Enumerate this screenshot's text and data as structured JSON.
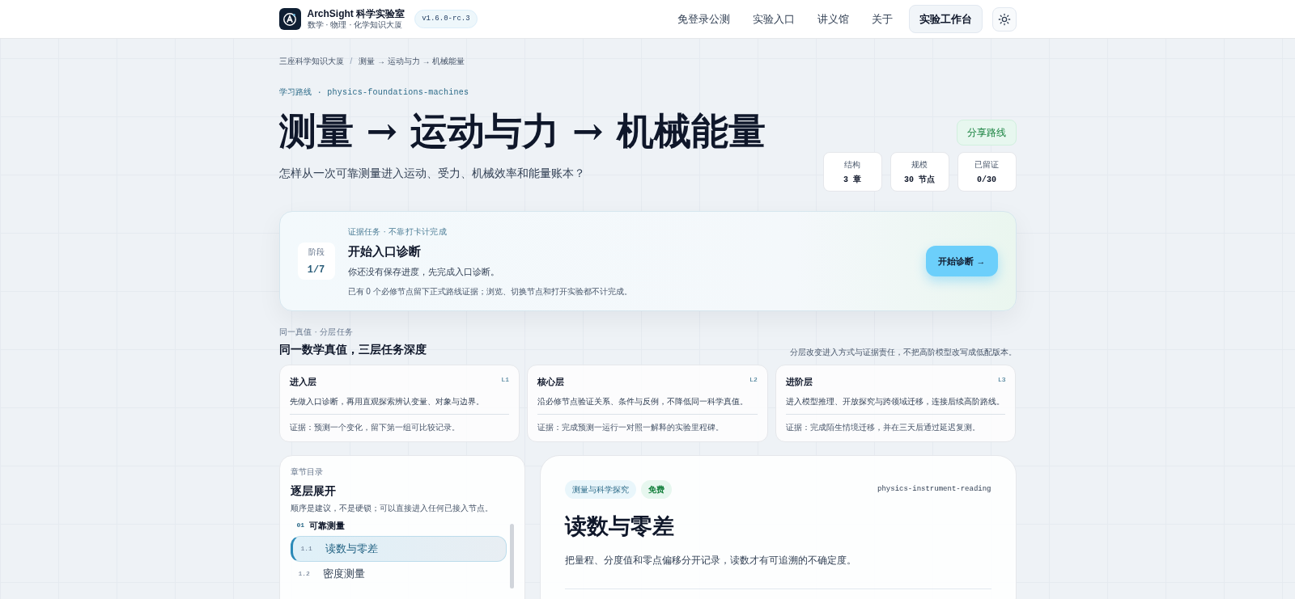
{
  "header": {
    "brand": "ArchSight 科学实验室",
    "tagline": "数学 · 物理 · 化学知识大厦",
    "version": "v1.6.0-rc.3",
    "nav": [
      {
        "label": "免登录公测",
        "kind": "link"
      },
      {
        "label": "实验入口",
        "kind": "link"
      },
      {
        "label": "讲义馆",
        "kind": "link"
      },
      {
        "label": "关于",
        "kind": "link"
      },
      {
        "label": "实验工作台",
        "kind": "button"
      }
    ]
  },
  "breadcrumb": [
    "三座科学知识大厦",
    "/",
    "测量 → 运动与力 → 机械能量"
  ],
  "eyebrow": "学习路线 · physics-foundations-machines",
  "title": "测量 → 运动与力 → 机械能量",
  "subtitle": "怎样从一次可靠测量进入运动、受力、机械效率和能量账本？",
  "share": "分享路线",
  "stats": [
    {
      "label": "结构",
      "value": "3 章"
    },
    {
      "label": "规模",
      "value": "30 节点"
    },
    {
      "label": "已留证",
      "value": "0/30"
    }
  ],
  "diagnosis": {
    "stage_label": "阶段",
    "stage": "1/7",
    "eyebrow": "证据任务 · 不靠打卡计完成",
    "title": "开始入口诊断",
    "text": "你还没有保存进度，先完成入口诊断。",
    "note": "已有 0 个必修节点留下正式路线证据；浏览、切换节点和打开实验都不计完成。",
    "button": "开始诊断 →"
  },
  "tiers": {
    "eyebrow": "同一真值 · 分层任务",
    "title": "同一数学真值，三层任务深度",
    "aside": "分层改变进入方式与证据责任，不把高阶模型改写成低配版本。",
    "cards": [
      {
        "title": "进入层",
        "level": "L1",
        "text": "先做入口诊断，再用直观探索辨认变量、对象与边界。",
        "evidence": "证据：预测一个变化，留下第一组可比较记录。"
      },
      {
        "title": "核心层",
        "level": "L2",
        "text": "沿必修节点验证关系、条件与反例，不降低同一科学真值。",
        "evidence": "证据：完成预测一运行一对照一解释的实验里程碑。"
      },
      {
        "title": "进阶层",
        "level": "L3",
        "text": "进入模型推理、开放探究与跨领域迁移，连接后续高阶路线。",
        "evidence": "证据：完成陌生情境迁移，并在三天后通过延迟复测。"
      }
    ]
  },
  "toc": {
    "eyebrow": "章节目录",
    "title": "逐层展开",
    "text": "顺序是建议，不是硬锁；可以直接进入任何已接入节点。",
    "chapters": [
      {
        "number": "01",
        "title": "可靠测量",
        "children": [
          {
            "number": "1.1",
            "title": "读数与零差",
            "selected": true
          },
          {
            "number": "1.2",
            "title": "密度测量",
            "selected": false
          }
        ]
      }
    ]
  },
  "node": {
    "tags": [
      {
        "label": "测量与科学探究",
        "kind": "topic"
      },
      {
        "label": "免费",
        "kind": "free"
      }
    ],
    "slug": "physics-instrument-reading",
    "title": "读数与零差",
    "text": "把量程、分度值和零点偏移分开记录，读数才有可追溯的不确定度。"
  }
}
